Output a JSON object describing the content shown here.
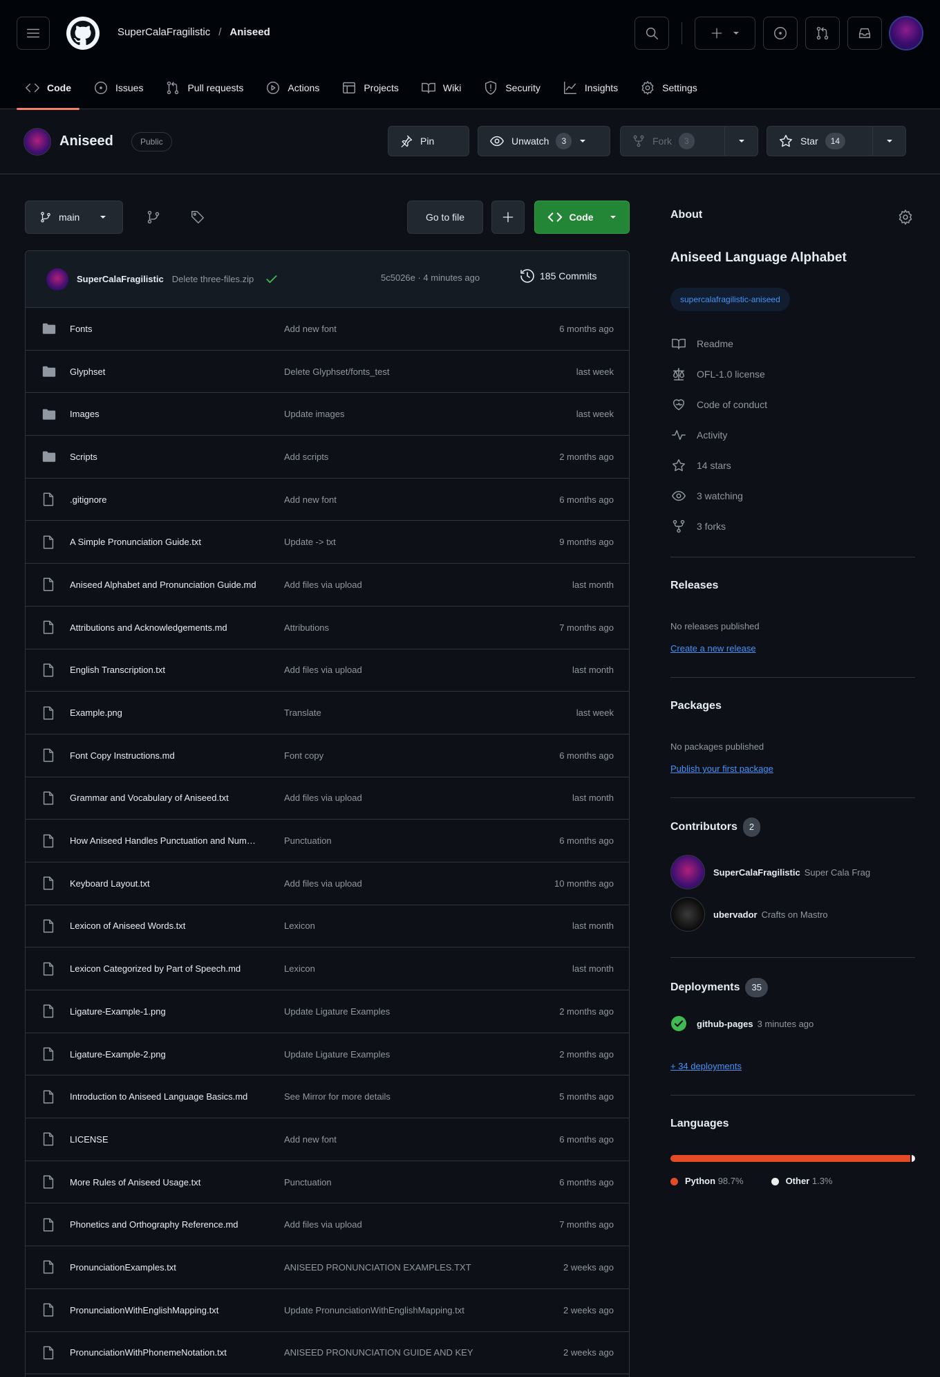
{
  "header": {
    "owner": "SuperCalaFragilistic",
    "separator": "/",
    "repo": "Aniseed",
    "tabs": [
      {
        "label": "Code",
        "icon": "code-icon"
      },
      {
        "label": "Issues",
        "icon": "issue-icon"
      },
      {
        "label": "Pull requests",
        "icon": "pull-request-icon"
      },
      {
        "label": "Actions",
        "icon": "play-icon"
      },
      {
        "label": "Projects",
        "icon": "table-icon"
      },
      {
        "label": "Wiki",
        "icon": "book-icon"
      },
      {
        "label": "Security",
        "icon": "shield-icon"
      },
      {
        "label": "Insights",
        "icon": "graph-icon"
      },
      {
        "label": "Settings",
        "icon": "gear-icon"
      }
    ]
  },
  "repo": {
    "name": "Aniseed",
    "visibility": "Public",
    "pin_label": "Pin",
    "watch_label": "Unwatch",
    "watch_count": "3",
    "fork_label": "Fork",
    "fork_count": "3",
    "star_label": "Star",
    "star_count": "14"
  },
  "toolbar": {
    "branch": "main",
    "goto_file": "Go to file",
    "code_label": "Code"
  },
  "commit": {
    "author": "SuperCalaFragilistic",
    "message": "Delete three-files.zip",
    "meta": "5c5026e · 4 minutes ago",
    "commits": "185 Commits"
  },
  "files": [
    {
      "type": "folder",
      "name": "Fonts",
      "message": "Add new font",
      "age": "6 months ago"
    },
    {
      "type": "folder",
      "name": "Glyphset",
      "message": "Delete Glyphset/fonts_test",
      "age": "last week"
    },
    {
      "type": "folder",
      "name": "Images",
      "message": "Update images",
      "age": "last week"
    },
    {
      "type": "folder",
      "name": "Scripts",
      "message": "Add scripts",
      "age": "2 months ago"
    },
    {
      "type": "file",
      "name": ".gitignore",
      "message": "Add new font",
      "age": "6 months ago"
    },
    {
      "type": "file",
      "name": "A Simple Pronunciation Guide.txt",
      "message": "Update -> txt",
      "age": "9 months ago"
    },
    {
      "type": "file",
      "name": "Aniseed Alphabet and Pronunciation Guide.md",
      "message": "Add files via upload",
      "age": "last month"
    },
    {
      "type": "file",
      "name": "Attributions and Acknowledgements.md",
      "message": "Attributions",
      "age": "7 months ago"
    },
    {
      "type": "file",
      "name": "English Transcription.txt",
      "message": "Add files via upload",
      "age": "last month"
    },
    {
      "type": "file",
      "name": "Example.png",
      "message": "Translate",
      "age": "last week"
    },
    {
      "type": "file",
      "name": "Font Copy Instructions.md",
      "message": "Font copy",
      "age": "6 months ago"
    },
    {
      "type": "file",
      "name": "Grammar and Vocabulary of Aniseed.txt",
      "message": "Add files via upload",
      "age": "last month"
    },
    {
      "type": "file",
      "name": "How Aniseed Handles Punctuation and Numbers.md",
      "message": "Punctuation",
      "age": "6 months ago"
    },
    {
      "type": "file",
      "name": "Keyboard Layout.txt",
      "message": "Add files via upload",
      "age": "10 months ago"
    },
    {
      "type": "file",
      "name": "Lexicon of Aniseed Words.txt",
      "message": "Lexicon",
      "age": "last month"
    },
    {
      "type": "file",
      "name": "Lexicon Categorized by Part of Speech.md",
      "message": "Lexicon",
      "age": "last month"
    },
    {
      "type": "file",
      "name": "Ligature-Example-1.png",
      "message": "Update Ligature Examples",
      "age": "2 months ago"
    },
    {
      "type": "file",
      "name": "Ligature-Example-2.png",
      "message": "Update Ligature Examples",
      "age": "2 months ago"
    },
    {
      "type": "file",
      "name": "Introduction to Aniseed Language Basics.md",
      "message": "See Mirror for more details",
      "age": "5 months ago"
    },
    {
      "type": "file",
      "name": "LICENSE",
      "message": "Add new font",
      "age": "6 months ago"
    },
    {
      "type": "file",
      "name": "More Rules of Aniseed Usage.txt",
      "message": "Punctuation",
      "age": "6 months ago"
    },
    {
      "type": "file",
      "name": "Phonetics and Orthography Reference.md",
      "message": "Add files via upload",
      "age": "7 months ago"
    },
    {
      "type": "file",
      "name": "PronunciationExamples.txt",
      "message": "ANISEED PRONUNCIATION EXAMPLES.TXT",
      "age": "2 weeks ago"
    },
    {
      "type": "file",
      "name": "PronunciationWithEnglishMapping.txt",
      "message": "Update PronunciationWithEnglishMapping.txt",
      "age": "2 weeks ago"
    },
    {
      "type": "file",
      "name": "PronunciationWithPhonemeNotation.txt",
      "message": "ANISEED PRONUNCIATION GUIDE AND KEY",
      "age": "2 weeks ago"
    }
  ],
  "sidebar": {
    "about_title": "About",
    "description": "Aniseed Language Alphabet",
    "topic": "supercalafragilistic-aniseed",
    "stats": [
      {
        "icon": "book-icon",
        "label": "Readme"
      },
      {
        "icon": "law-icon",
        "label": "OFL-1.0 license"
      },
      {
        "icon": "heart-icon",
        "label": "Code of conduct"
      },
      {
        "icon": "pulse-icon",
        "label": "Activity"
      },
      {
        "icon": "star-icon",
        "label": "14 stars"
      },
      {
        "icon": "eye-icon",
        "label": "3 watching"
      },
      {
        "icon": "fork-icon",
        "label": "3 forks"
      }
    ],
    "releases_title": "Releases",
    "releases_text": "No releases published",
    "releases_link": "Create a new release",
    "packages_title": "Packages",
    "packages_text": "No packages published",
    "packages_link": "Publish your first package",
    "contributors_title": "Contributors",
    "contributors_count": "2",
    "contributors": [
      {
        "name": "SuperCalaFragilistic",
        "role": "Super Cala Frag"
      },
      {
        "name": "ubervador",
        "role": "Crafts on Mastro"
      }
    ],
    "deployments_title": "Deployments",
    "deployments_count": "35",
    "deployment": {
      "name": "github-pages",
      "age": "3 minutes ago"
    },
    "deployments_link": "+ 34 deployments",
    "languages_title": "Languages",
    "languages": [
      {
        "name": "Python",
        "pct": "98.7%",
        "value": 98.7,
        "color": "#e34c26"
      },
      {
        "name": "Other",
        "pct": "1.3%",
        "value": 1.3,
        "color": "#ededed"
      }
    ]
  }
}
